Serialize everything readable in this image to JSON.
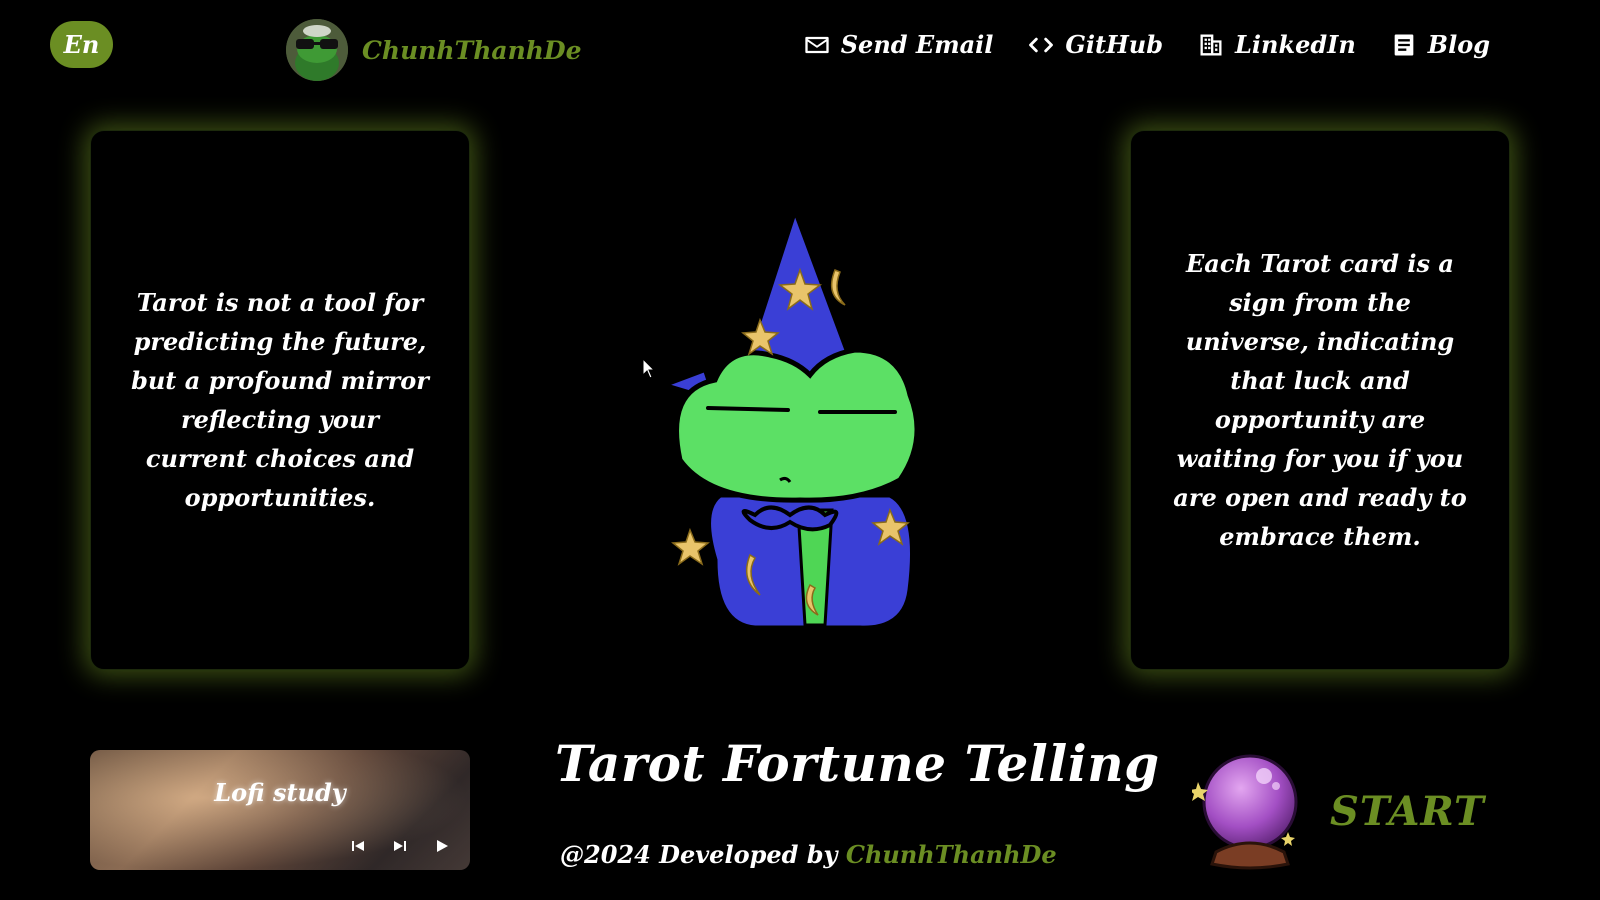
{
  "header": {
    "language_label": "En",
    "brand_name": "ChunhThanhDe",
    "nav": [
      {
        "label": "Send Email",
        "icon": "mail-icon"
      },
      {
        "label": "GitHub",
        "icon": "code-icon"
      },
      {
        "label": "LinkedIn",
        "icon": "building-icon"
      },
      {
        "label": "Blog",
        "icon": "document-icon"
      }
    ]
  },
  "cards": {
    "left": "Tarot is not a tool for predicting the future, but a profound mirror reflecting your current choices and opportunities.",
    "right": "Each Tarot card is a sign from the universe, indicating that luck and opportunity are waiting for you if you are open and ready to embrace them."
  },
  "player": {
    "title": "Lofi study"
  },
  "main": {
    "title": "Tarot Fortune Telling",
    "footer_prefix": "@2024 Developed by",
    "footer_dev": "ChunhThanhDe"
  },
  "start": {
    "label": "START"
  },
  "colors": {
    "accent": "#6b8e23",
    "background": "#000000",
    "text": "#ffffff"
  }
}
